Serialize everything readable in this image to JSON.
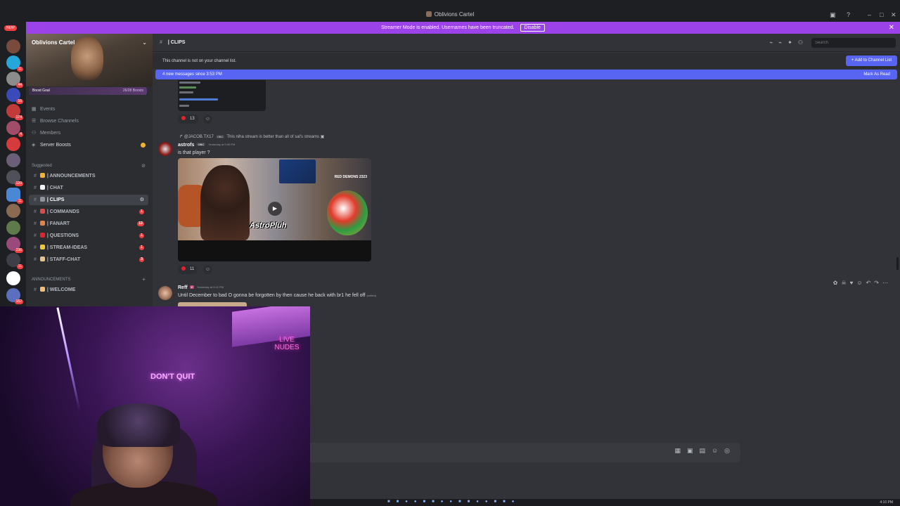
{
  "window": {
    "title": "Oblivions Cartel"
  },
  "streamer_bar": {
    "text": "Streamer Mode is enabled. Usernames have been truncated.",
    "disable_label": "Disable"
  },
  "server_rail": {
    "new_label": "NEW",
    "badges": [
      "11",
      "44",
      "16",
      "174",
      "4",
      "120",
      "11",
      "4",
      "236",
      "11",
      "182"
    ]
  },
  "server": {
    "name": "Oblivions Cartel",
    "boost_label": "Boost Goal",
    "boost_progress": "26/28 Boosts",
    "nav": [
      "Events",
      "Browse Channels",
      "Members",
      "Server Boosts"
    ],
    "section_suggested": "Suggested",
    "section_announcements": "ANNOUNCEMENTS",
    "channels": [
      {
        "name": "| ANNOUNCEMENTS",
        "count": ""
      },
      {
        "name": "| CHAT",
        "count": ""
      },
      {
        "name": "| CLIPS",
        "count": ""
      },
      {
        "name": "| COMMANDS",
        "count": "1"
      },
      {
        "name": "| FANART",
        "count": "13"
      },
      {
        "name": "| QUESTIONS",
        "count": "1"
      },
      {
        "name": "| STREAM-IDEAS",
        "count": "1"
      },
      {
        "name": "| STAFF-CHAT",
        "count": "3"
      }
    ],
    "welcome_channel": "| WELCOME"
  },
  "main": {
    "channel_title": "| CLIPS",
    "search_placeholder": "Search",
    "notice_text": "This channel is not on your channel list.",
    "add_button": "+ Add to Channel List",
    "new_messages": "4 new messages since 3:53 PM",
    "mark_read": "Mark As Read",
    "messages": [
      {
        "reactions": "13"
      },
      {
        "reply_user": "@JACOB.TX17",
        "reply_tag": "OBC",
        "reply_text": "This niha stream is better than all of sal's streams",
        "author": "astrofs",
        "tag": "OBC",
        "time": "Yesterday at 9:06 PM",
        "text": "is that player ?",
        "video_watermark": "AstroPluh",
        "video_corner": "RED DEMONS 2323",
        "reactions": "11"
      },
      {
        "author": "Reff",
        "time": "Yesterday at 9:41 PM",
        "text": "Until December to bad O gonna be forgotten by then cause he back with br1 he fell off",
        "edited": "(edited)"
      }
    ]
  },
  "webcam": {
    "sign_left": "DON'T QUIT",
    "sign_right": "LIVE NUDES"
  },
  "taskbar": {
    "clock": "4:10 PM"
  },
  "colors": {
    "accent": "#5865f2",
    "streamer_bar": "#9b43e8",
    "badge": "#f23f42"
  }
}
